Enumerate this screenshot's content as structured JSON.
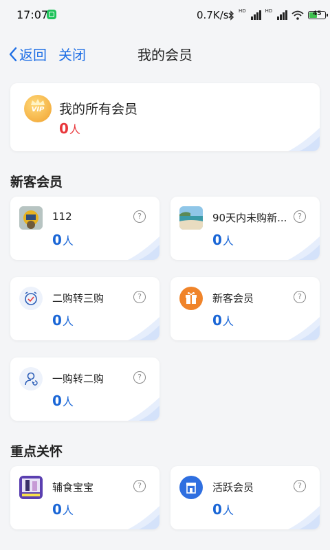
{
  "status_bar": {
    "time": "17:07",
    "network_speed": "0.7K/s",
    "battery_level": "45",
    "icons": [
      "app-notification-icon",
      "bluetooth-icon",
      "signal-icon",
      "signal-icon",
      "wifi-icon",
      "battery-icon",
      "charging-icon"
    ]
  },
  "nav": {
    "back_label": "返回",
    "close_label": "关闭",
    "title": "我的会员"
  },
  "all_members": {
    "title": "我的所有会员",
    "count": "0",
    "unit": "人",
    "icon": "vip-crown-icon"
  },
  "sections": [
    {
      "title": "新客会员",
      "cards": [
        {
          "name": "112",
          "count": "0",
          "unit": "人",
          "icon": "photo-thumbnail"
        },
        {
          "name": "90天内未购新...",
          "count": "0",
          "unit": "人",
          "icon": "beach-photo-thumbnail"
        },
        {
          "name": "二购转三购",
          "count": "0",
          "unit": "人",
          "icon": "alarm-clock-icon"
        },
        {
          "name": "新客会员",
          "count": "0",
          "unit": "人",
          "icon": "gift-box-icon"
        },
        {
          "name": "一购转二购",
          "count": "0",
          "unit": "人",
          "icon": "user-refresh-icon"
        }
      ]
    },
    {
      "title": "重点关怀",
      "cards": [
        {
          "name": "辅食宝宝",
          "count": "0",
          "unit": "人",
          "icon": "product-photo-thumbnail"
        },
        {
          "name": "活跃会员",
          "count": "0",
          "unit": "人",
          "icon": "store-icon"
        }
      ]
    }
  ],
  "colors": {
    "accent": "#1f6fe5",
    "count_blue": "#1a66d6",
    "count_red": "#e8363a",
    "background": "#f4f5f7"
  }
}
